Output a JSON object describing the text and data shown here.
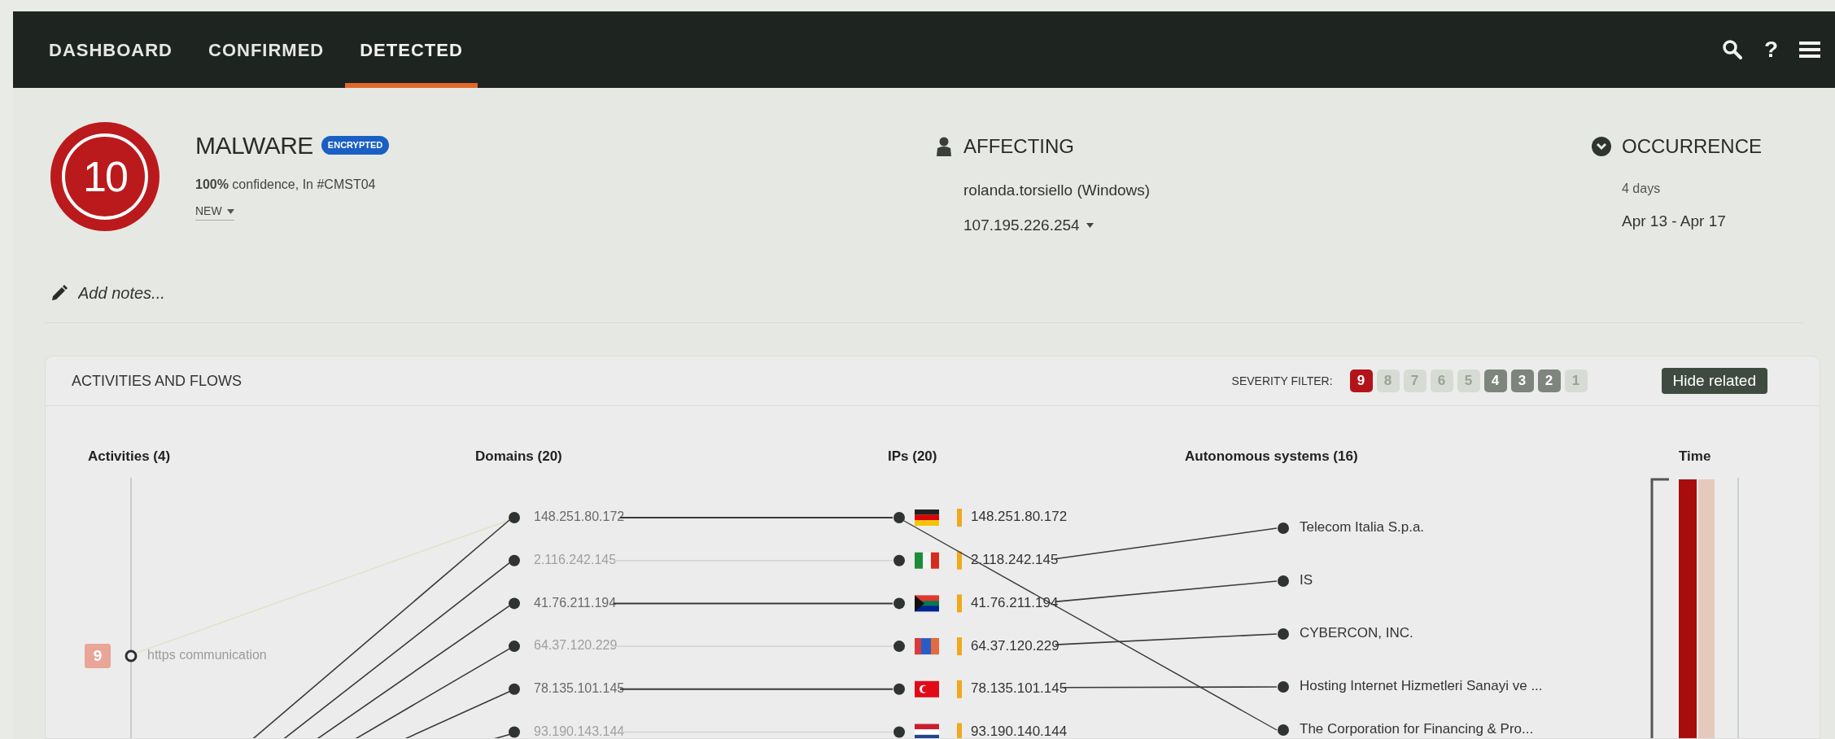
{
  "nav": {
    "tabs": [
      {
        "label": "DASHBOARD",
        "selected": false
      },
      {
        "label": "CONFIRMED",
        "selected": false
      },
      {
        "label": "DETECTED",
        "selected": true
      }
    ],
    "help": "?"
  },
  "threat": {
    "severity": "10",
    "title": "MALWARE",
    "badge": "ENCRYPTED",
    "confidence": "**100%** confidence, In #CMST04",
    "status": "NEW"
  },
  "affecting": {
    "heading": "AFFECTING",
    "user": "rolanda.torsiello (Windows)",
    "ip": "107.195.226.254"
  },
  "occurrence": {
    "heading": "OCCURRENCE",
    "duration": "4 days",
    "range": "Apr 13 - Apr 17"
  },
  "notes": {
    "placeholder": "Add notes..."
  },
  "flows": {
    "title": "ACTIVITIES AND FLOWS",
    "severity_filter_label": "SEVERITY FILTER:",
    "severity_filter": [
      {
        "label": "9",
        "selected": true,
        "disabled": false
      },
      {
        "label": "8",
        "selected": false,
        "disabled": true
      },
      {
        "label": "7",
        "selected": false,
        "disabled": true
      },
      {
        "label": "6",
        "selected": false,
        "disabled": true
      },
      {
        "label": "5",
        "selected": false,
        "disabled": true
      },
      {
        "label": "4",
        "selected": false,
        "disabled": false
      },
      {
        "label": "3",
        "selected": false,
        "disabled": false
      },
      {
        "label": "2",
        "selected": false,
        "disabled": false
      },
      {
        "label": "1",
        "selected": false,
        "disabled": true
      }
    ],
    "hide_related": "Hide related",
    "columns": [
      "Activities (4)",
      "Domains (20)",
      "IPs (20)",
      "Autonomous systems (16)",
      "Time"
    ],
    "activities": [
      {
        "severity": "9",
        "label": "https communication",
        "highlighted": false
      }
    ],
    "domains": [
      {
        "label": "148.251.80.172",
        "highlighted": true
      },
      {
        "label": "2.116.242.145",
        "highlighted": false
      },
      {
        "label": "41.76.211.194",
        "highlighted": true
      },
      {
        "label": "64.37.120.229",
        "highlighted": false
      },
      {
        "label": "78.135.101.145",
        "highlighted": true
      },
      {
        "label": "93.190.143.144",
        "highlighted": false
      }
    ],
    "ips": [
      {
        "label": "148.251.80.172",
        "kind": "de"
      },
      {
        "label": "2.118.242.145",
        "kind": "it"
      },
      {
        "label": "41.76.211.194",
        "kind": "za"
      },
      {
        "label": "64.37.120.229",
        "kind": "mn"
      },
      {
        "label": "78.135.101.145",
        "kind": "tr"
      },
      {
        "label": "93.190.140.144",
        "kind": "nl"
      }
    ],
    "autonomous_systems": [
      "Telecom Italia S.p.a.",
      "IS",
      "CYBERCON, INC.",
      "Hosting Internet Hizmetleri Sanayi ve ...",
      "The Corporation for Financing & Pro..."
    ]
  }
}
